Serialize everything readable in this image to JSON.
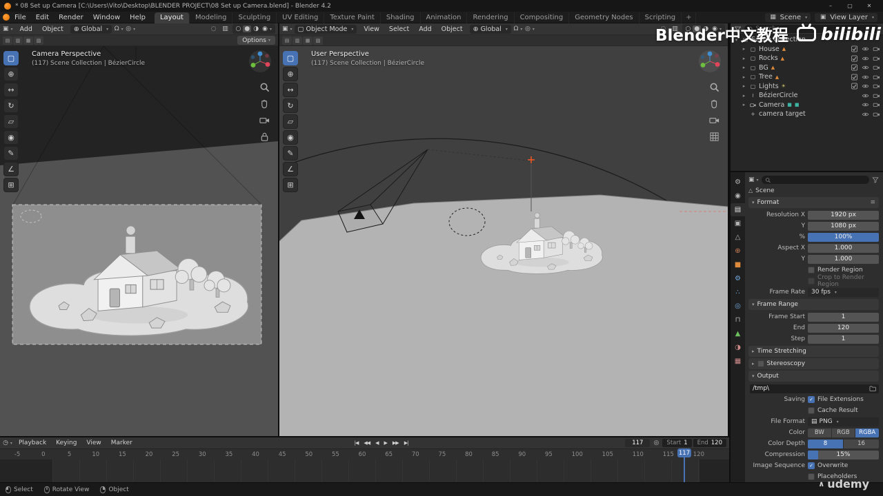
{
  "titlebar": {
    "title": "* 08 Set up Camera [C:\\Users\\Vito\\Desktop\\BLENDER PROJECT\\08 Set up Camera.blend] - Blender 4.2",
    "minimize": "–",
    "maximize": "▢",
    "close": "✕"
  },
  "topbar": {
    "menus": [
      "File",
      "Edit",
      "Render",
      "Window",
      "Help"
    ],
    "workspaces": [
      "Layout",
      "Modeling",
      "Sculpting",
      "UV Editing",
      "Texture Paint",
      "Shading",
      "Animation",
      "Rendering",
      "Compositing",
      "Geometry Nodes",
      "Scripting"
    ],
    "active_workspace": "Layout",
    "add_tab": "+",
    "scene_label": "Scene",
    "view_layer_label": "View Layer"
  },
  "icons": {
    "editor_3d_viewport": "▣",
    "editor_timeline": "◷",
    "orientation_globe": "⊕",
    "magnet": "Ω",
    "proportional": "◎",
    "overlays": "◌",
    "xray": "▥",
    "shading_wireframe": "○",
    "shading_solid": "●",
    "shading_material": "◑",
    "shading_rendered": "◉",
    "mode_object": "▢",
    "scene_icon": "▦",
    "view_layer_icon": "▣",
    "preset_menu": "≡",
    "file_format_icon": "▤",
    "breadcrumb_icon": "△",
    "auto_keying": "◎"
  },
  "tools": [
    {
      "id": "select-box",
      "glyph": "▢"
    },
    {
      "id": "cursor",
      "glyph": "⊕"
    },
    {
      "id": "move",
      "glyph": "↔"
    },
    {
      "id": "rotate",
      "glyph": "↻"
    },
    {
      "id": "scale",
      "glyph": "▱"
    },
    {
      "id": "transform",
      "glyph": "◉"
    },
    {
      "id": "annotate",
      "glyph": "✎"
    },
    {
      "id": "measure",
      "glyph": "∠"
    },
    {
      "id": "add-cube",
      "glyph": "⊞"
    }
  ],
  "tool_settings_icons": [
    "▤",
    "▥",
    "▦",
    "▧"
  ],
  "viewport_left": {
    "menus": [
      "Add",
      "Object"
    ],
    "orientation": "Global",
    "options_label": "Options",
    "view_name": "Camera Perspective",
    "context": "(117) Scene Collection | BézierCircle"
  },
  "viewport_right": {
    "mode": "Object Mode",
    "menus": [
      "View",
      "Select",
      "Add",
      "Object"
    ],
    "orientation": "Global",
    "view_name": "User Perspective",
    "context": "(117) Scene Collection | BézierCircle"
  },
  "outliner": {
    "icon_glyphs": {
      "collection": "▢",
      "curve": "≀",
      "empty": "+"
    },
    "badge_glyphs": {
      "mesh": "▲",
      "light": "☀",
      "data": "■"
    },
    "rows": [
      {
        "label": "Scene Collection",
        "icon": "collection",
        "expand": "▾",
        "indent": 0,
        "badges": [],
        "controls": []
      },
      {
        "label": "House",
        "icon": "collection",
        "expand": "▸",
        "indent": 1,
        "badges": [
          "mesh"
        ],
        "controls": [
          "check",
          "eye",
          "cam"
        ]
      },
      {
        "label": "Rocks",
        "icon": "collection",
        "expand": "▸",
        "indent": 1,
        "badges": [
          "mesh"
        ],
        "controls": [
          "check",
          "eye",
          "cam"
        ]
      },
      {
        "label": "BG",
        "icon": "collection",
        "expand": "▸",
        "indent": 1,
        "badges": [
          "mesh"
        ],
        "controls": [
          "check",
          "eye",
          "cam"
        ]
      },
      {
        "label": "Tree",
        "icon": "collection",
        "expand": "▸",
        "indent": 1,
        "badges": [
          "mesh"
        ],
        "controls": [
          "check",
          "eye",
          "cam"
        ]
      },
      {
        "label": "Lights",
        "icon": "collection",
        "expand": "▸",
        "indent": 1,
        "badges": [
          "light"
        ],
        "controls": [
          "check",
          "eye",
          "cam"
        ]
      },
      {
        "label": "BézierCircle",
        "icon": "curve",
        "expand": "▸",
        "indent": 1,
        "badges": [],
        "controls": [
          "eye",
          "cam"
        ]
      },
      {
        "label": "Camera",
        "icon": "camera",
        "expand": "▸",
        "indent": 1,
        "badges": [
          "data",
          "data"
        ],
        "controls": [
          "eye",
          "cam"
        ]
      },
      {
        "label": "camera target",
        "icon": "empty",
        "expand": "",
        "indent": 1,
        "badges": [],
        "controls": [
          "eye",
          "cam"
        ]
      }
    ]
  },
  "properties": {
    "search_placeholder": "Search",
    "breadcrumb": "Scene",
    "active_tab": "output",
    "tabs": [
      {
        "id": "tool",
        "glyph": "⚙",
        "color": "#b4b4b4"
      },
      {
        "id": "render",
        "glyph": "◉",
        "color": "#b4b4b4"
      },
      {
        "id": "output",
        "glyph": "▤",
        "color": "#e0e0e0"
      },
      {
        "id": "view-layer",
        "glyph": "▣",
        "color": "#b4b4b4"
      },
      {
        "id": "scene",
        "glyph": "△",
        "color": "#b4b4b4"
      },
      {
        "id": "world",
        "glyph": "⊕",
        "color": "#c97f55"
      },
      {
        "id": "object",
        "glyph": "■",
        "color": "#dd8a3c"
      },
      {
        "id": "modifiers",
        "glyph": "⚙",
        "color": "#71a8dd"
      },
      {
        "id": "particles",
        "glyph": "∴",
        "color": "#71a8dd"
      },
      {
        "id": "physics",
        "glyph": "◎",
        "color": "#71a8dd"
      },
      {
        "id": "constraints",
        "glyph": "⊓",
        "color": "#b4b4b4"
      },
      {
        "id": "object-data",
        "glyph": "▲",
        "color": "#6cbf5e"
      },
      {
        "id": "material",
        "glyph": "◑",
        "color": "#cf8a8a"
      },
      {
        "id": "texture",
        "glyph": "▦",
        "color": "#cf8a8a"
      }
    ],
    "format": {
      "title": "Format",
      "resolution_x_label": "Resolution X",
      "resolution_x": "1920 px",
      "resolution_y_label": "Y",
      "resolution_y": "1080 px",
      "percent_label": "%",
      "percent": "100%",
      "aspect_x_label": "Aspect X",
      "aspect_x": "1.000",
      "aspect_y_label": "Y",
      "aspect_y": "1.000",
      "render_region_label": "Render Region",
      "crop_label": "Crop to Render Region",
      "frame_rate_label": "Frame Rate",
      "frame_rate": "30 fps"
    },
    "frame_range": {
      "title": "Frame Range",
      "frame_start_label": "Frame Start",
      "frame_start": "1",
      "end_label": "End",
      "end": "120",
      "step_label": "Step",
      "step": "1"
    },
    "time_stretching_title": "Time Stretching",
    "stereoscopy_title": "Stereoscopy",
    "output": {
      "title": "Output",
      "path": "/tmp\\",
      "saving_label": "Saving",
      "file_extensions_label": "File Extensions",
      "cache_result_label": "Cache Result",
      "file_format_label": "File Format",
      "file_format": "PNG",
      "color_label": "Color",
      "color_options": [
        "BW",
        "RGB",
        "RGBA"
      ],
      "color_active": "RGBA",
      "color_depth_label": "Color Depth",
      "color_depth_options": [
        "8",
        "16"
      ],
      "color_depth_active": "8",
      "compression_label": "Compression",
      "compression": "15%",
      "image_sequence_label": "Image Sequence",
      "overwrite_label": "Overwrite",
      "placeholders_label": "Placeholders"
    }
  },
  "timeline": {
    "menus": [
      "Playback",
      "Keying",
      "View",
      "Marker"
    ],
    "playback_buttons": [
      {
        "id": "jump-to-start",
        "glyph": "|◀"
      },
      {
        "id": "jump-to-prev-keyframe",
        "glyph": "◀◀"
      },
      {
        "id": "play-reverse",
        "glyph": "◀"
      },
      {
        "id": "play",
        "glyph": "▶"
      },
      {
        "id": "jump-to-next-keyframe",
        "glyph": "▶▶"
      },
      {
        "id": "jump-to-end",
        "glyph": "▶|"
      }
    ],
    "current_frame": "117",
    "start_label": "Start",
    "start_value": "1",
    "end_label": "End",
    "end_value": "120",
    "ruler": [
      "-5",
      "0",
      "5",
      "10",
      "15",
      "20",
      "25",
      "30",
      "35",
      "40",
      "45",
      "50",
      "55",
      "60",
      "65",
      "70",
      "75",
      "80",
      "85",
      "90",
      "95",
      "100",
      "105",
      "110",
      "115",
      "120"
    ]
  },
  "statusbar": {
    "hints": [
      {
        "mouse": "left",
        "label": "Select"
      },
      {
        "mouse": "middle",
        "label": "Rotate View"
      },
      {
        "mouse": "right",
        "label": "Object"
      }
    ]
  },
  "watermarks": {
    "channel": "Blender中文教程",
    "bilibili": "bilibili",
    "udemy": "udemy"
  }
}
